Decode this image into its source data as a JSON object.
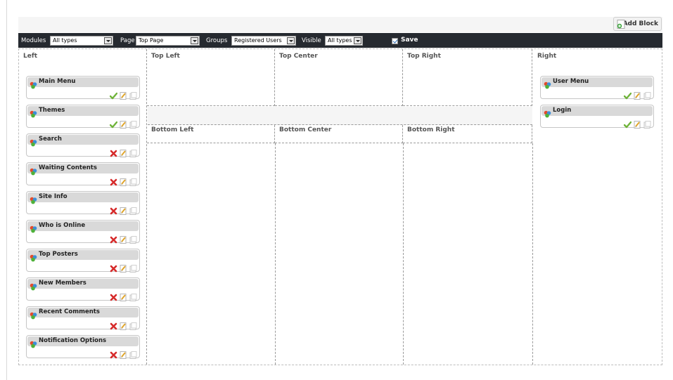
{
  "header": {
    "add_block_label": "Add Block"
  },
  "toolbar": {
    "modules_label": "Modules",
    "modules_value": "All types",
    "page_label": "Page",
    "page_value": "Top Page",
    "groups_label": "Groups",
    "groups_value": "Registered Users",
    "visible_label": "Visible",
    "visible_value": "All types",
    "save_label": "Save"
  },
  "columns": {
    "left": "Left",
    "top_left": "Top Left",
    "top_center": "Top Center",
    "top_right": "Top Right",
    "bottom_left": "Bottom Left",
    "bottom_center": "Bottom Center",
    "bottom_right": "Bottom Right",
    "right": "Right"
  },
  "left_blocks": [
    {
      "title": "Main Menu",
      "visible": true
    },
    {
      "title": "Themes",
      "visible": true
    },
    {
      "title": "Search",
      "visible": false
    },
    {
      "title": "Waiting Contents",
      "visible": false
    },
    {
      "title": "Site Info",
      "visible": false
    },
    {
      "title": "Who is Online",
      "visible": false
    },
    {
      "title": "Top Posters",
      "visible": false
    },
    {
      "title": "New Members",
      "visible": false
    },
    {
      "title": "Recent Comments",
      "visible": false
    },
    {
      "title": "Notification Options",
      "visible": false
    }
  ],
  "right_blocks": [
    {
      "title": "User Menu",
      "visible": true
    },
    {
      "title": "Login",
      "visible": true
    }
  ],
  "colors": {
    "toolbar_bg": "#262a30",
    "block_head": "#d9d9d9",
    "visible_green": "#6fb33a",
    "hidden_red": "#d62a2a"
  },
  "icons": {
    "block": "blocks-icon",
    "visible": "check-icon",
    "hidden": "cross-icon",
    "edit": "edit-icon",
    "clone": "clone-icon",
    "add": "add-icon"
  }
}
